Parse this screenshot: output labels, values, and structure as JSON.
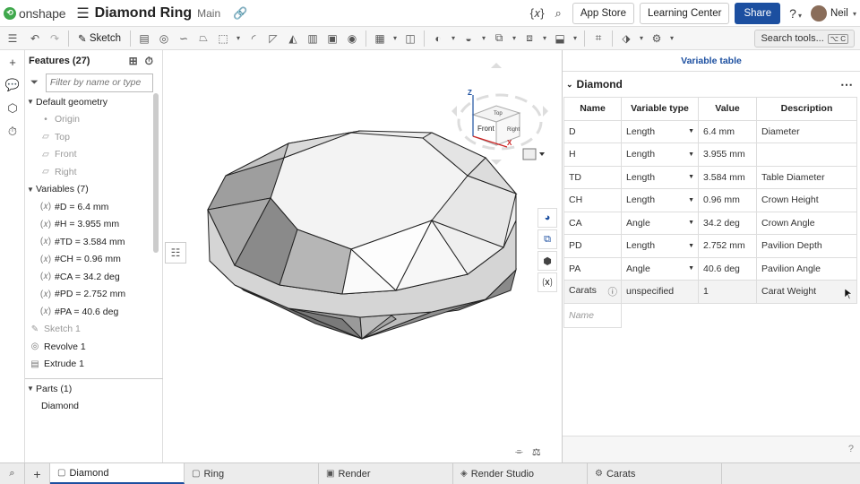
{
  "app": {
    "logo_mark": "⟲",
    "brand": "onshape",
    "doc_title": "Diamond Ring",
    "branch": "Main"
  },
  "topbar": {
    "app_store": "App Store",
    "learning_center": "Learning Center",
    "share": "Share",
    "help": "?",
    "user": "Neil",
    "caret": "▾"
  },
  "toolbar": {
    "sketch_label": "Sketch",
    "search_tools": "Search tools...",
    "search_shortcut": "⌥ C"
  },
  "features": {
    "header": "Features (27)",
    "filter_placeholder": "Filter by name or type",
    "items": [
      {
        "type": "group",
        "label": "Default geometry"
      },
      {
        "type": "child",
        "icon": "•",
        "label": "Origin",
        "muted": true
      },
      {
        "type": "child",
        "icon": "▱",
        "label": "Top",
        "muted": true
      },
      {
        "type": "child",
        "icon": "▱",
        "label": "Front",
        "muted": true
      },
      {
        "type": "child",
        "icon": "▱",
        "label": "Right",
        "muted": true
      },
      {
        "type": "group",
        "label": "Variables (7)"
      },
      {
        "type": "child",
        "icon": "(𝑥)",
        "label": "#D = 6.4 mm"
      },
      {
        "type": "child",
        "icon": "(𝑥)",
        "label": "#H = 3.955 mm"
      },
      {
        "type": "child",
        "icon": "(𝑥)",
        "label": "#TD = 3.584 mm"
      },
      {
        "type": "child",
        "icon": "(𝑥)",
        "label": "#CH = 0.96 mm"
      },
      {
        "type": "child",
        "icon": "(𝑥)",
        "label": "#CA = 34.2 deg"
      },
      {
        "type": "child",
        "icon": "(𝑥)",
        "label": "#PD = 2.752 mm"
      },
      {
        "type": "child",
        "icon": "(𝑥)",
        "label": "#PA = 40.6 deg"
      },
      {
        "type": "top",
        "icon": "✎",
        "label": "Sketch 1",
        "muted": true
      },
      {
        "type": "top",
        "icon": "◎",
        "label": "Revolve 1"
      },
      {
        "type": "top",
        "icon": "▤",
        "label": "Extrude 1"
      }
    ],
    "parts_header": "Parts (1)",
    "parts": [
      "Diamond"
    ]
  },
  "viewcube": {
    "front": "Front",
    "top": "Top",
    "right": "Right",
    "axis_z": "Z",
    "axis_x": "X"
  },
  "variable_table": {
    "panel_title": "Variable table",
    "table_name": "Diamond",
    "columns": [
      "Name",
      "Variable type",
      "Value",
      "Description"
    ],
    "rows": [
      {
        "name": "D",
        "type": "Length",
        "value": "6.4 mm",
        "description": "Diameter"
      },
      {
        "name": "H",
        "type": "Length",
        "value": "3.955 mm",
        "description": ""
      },
      {
        "name": "TD",
        "type": "Length",
        "value": "3.584 mm",
        "description": "Table Diameter"
      },
      {
        "name": "CH",
        "type": "Length",
        "value": "0.96 mm",
        "description": "Crown Height"
      },
      {
        "name": "CA",
        "type": "Angle",
        "value": "34.2 deg",
        "description": "Crown Angle"
      },
      {
        "name": "PD",
        "type": "Length",
        "value": "2.752 mm",
        "description": "Pavilion Depth"
      },
      {
        "name": "PA",
        "type": "Angle",
        "value": "40.6 deg",
        "description": "Pavilion Angle"
      },
      {
        "name": "Carats",
        "type": "unspecified",
        "value": "1",
        "description": "Carat Weight",
        "info": "ⓘ"
      }
    ],
    "new_name_placeholder": "Name"
  },
  "tabs": [
    {
      "label": "Diamond",
      "icon": "▢",
      "active": true
    },
    {
      "label": "Ring",
      "icon": "▢"
    },
    {
      "label": "Render",
      "icon": "▣"
    },
    {
      "label": "Render Studio",
      "icon": "◈"
    },
    {
      "label": "Carats",
      "icon": "⚙"
    }
  ],
  "colors": {
    "accent": "#1c4fa0",
    "brand_green": "#3fa84c"
  }
}
